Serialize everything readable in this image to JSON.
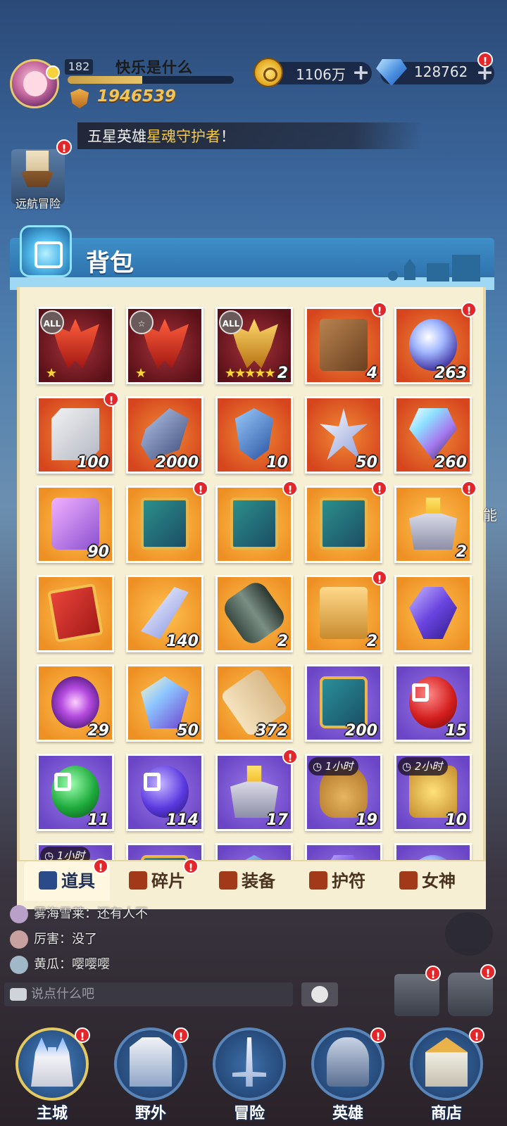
{
  "player": {
    "level": "182",
    "name": "快乐是什么",
    "power": "1946539",
    "exp_fraction": 0.45
  },
  "resources": {
    "gold": "1106万",
    "gems": "128762",
    "gem_badge": "!"
  },
  "announcement": {
    "prefix": "五星英雄",
    "highlight": "星魂守护者",
    "suffix": "！"
  },
  "voyage": {
    "label": "远航冒险",
    "badge": "!"
  },
  "bag": {
    "title": "背包"
  },
  "items": [
    {
      "art": "a-mask",
      "bg": "dark",
      "tag": "ALL",
      "count": "",
      "badge": false,
      "stars": "★"
    },
    {
      "art": "a-mask",
      "bg": "dark",
      "tag": "☆",
      "count": "",
      "badge": false,
      "stars": "★"
    },
    {
      "art": "a-mask gold",
      "bg": "dark",
      "tag": "ALL",
      "count": "2",
      "badge": false,
      "stars": "★★★★★"
    },
    {
      "art": "a-book",
      "bg": "red",
      "count": "4",
      "badge": true
    },
    {
      "art": "a-orb",
      "bg": "red",
      "count": "263",
      "badge": true
    },
    {
      "art": "a-cube",
      "bg": "red",
      "count": "100",
      "badge": true
    },
    {
      "art": "a-rock",
      "bg": "red",
      "count": "2000",
      "badge": false
    },
    {
      "art": "a-crystal",
      "bg": "red",
      "count": "10",
      "badge": false
    },
    {
      "art": "a-star",
      "bg": "red",
      "count": "50",
      "badge": false
    },
    {
      "art": "a-gem",
      "bg": "red",
      "count": "260",
      "badge": false
    },
    {
      "art": "a-puzzle",
      "bg": "orange",
      "count": "90",
      "badge": false
    },
    {
      "art": "a-card",
      "bg": "orange",
      "count": "",
      "badge": true
    },
    {
      "art": "a-card",
      "bg": "orange",
      "count": "",
      "badge": true
    },
    {
      "art": "a-card",
      "bg": "orange",
      "count": "",
      "badge": true
    },
    {
      "art": "a-altar",
      "bg": "orange",
      "count": "2",
      "badge": true
    },
    {
      "art": "a-redcard",
      "bg": "orange",
      "count": "",
      "badge": false
    },
    {
      "art": "a-shard",
      "bg": "orange",
      "count": "140",
      "badge": false
    },
    {
      "art": "a-tube",
      "bg": "orange",
      "count": "2",
      "badge": false
    },
    {
      "art": "a-chest",
      "bg": "orange",
      "count": "2",
      "badge": true
    },
    {
      "art": "a-bigem",
      "bg": "orange",
      "count": "",
      "badge": false
    },
    {
      "art": "a-swirl",
      "bg": "orange",
      "count": "29",
      "badge": false
    },
    {
      "art": "a-frame",
      "bg": "orange",
      "count": "50",
      "badge": false
    },
    {
      "art": "a-scroll",
      "bg": "orange",
      "count": "372",
      "badge": false
    },
    {
      "art": "a-shield",
      "bg": "purple",
      "count": "200",
      "badge": false
    },
    {
      "art": "a-ball-red",
      "bg": "purple",
      "count": "15",
      "badge": false
    },
    {
      "art": "a-ball-green",
      "bg": "purple",
      "count": "11",
      "badge": false
    },
    {
      "art": "a-ball-blue",
      "bg": "purple",
      "count": "114",
      "badge": false
    },
    {
      "art": "a-altar",
      "bg": "purple",
      "count": "17",
      "badge": true
    },
    {
      "art": "a-bag",
      "bg": "purple",
      "count": "19",
      "badge": false,
      "timer": "1小时"
    },
    {
      "art": "a-goldbag",
      "bg": "purple",
      "count": "10",
      "badge": false,
      "timer": "2小时"
    },
    {
      "art": "a-bag",
      "bg": "purple",
      "count": "",
      "badge": false,
      "timer": "1小时"
    },
    {
      "art": "a-shield",
      "bg": "purple",
      "count": "",
      "badge": false
    },
    {
      "art": "a-crystal",
      "bg": "purple",
      "count": "",
      "badge": false
    },
    {
      "art": "a-bigem",
      "bg": "purple",
      "count": "",
      "badge": false
    },
    {
      "art": "a-orb",
      "bg": "purple",
      "count": "",
      "badge": false
    }
  ],
  "tabs": [
    {
      "label": "道具",
      "badge": "!",
      "active": true,
      "icon_color": "#2a4a8a"
    },
    {
      "label": "碎片",
      "badge": "!",
      "active": false,
      "icon_color": "#a23a1a"
    },
    {
      "label": "装备",
      "badge": "",
      "active": false,
      "icon_color": "#a23a1a"
    },
    {
      "label": "护符",
      "badge": "",
      "active": false,
      "icon_color": "#a23a1a"
    },
    {
      "label": "女神",
      "badge": "",
      "active": false,
      "icon_color": "#a23a1a"
    }
  ],
  "chat": {
    "messages": [
      {
        "text": "雾海雪莱：还有人不"
      },
      {
        "text": "厉害：没了"
      },
      {
        "text": "黄瓜：嘤嘤嘤"
      }
    ],
    "placeholder": "说点什么吧"
  },
  "side": {
    "right_edge_text": "能"
  },
  "nav": [
    {
      "label": "主城",
      "badge": "!",
      "active": true,
      "art": "castle"
    },
    {
      "label": "野外",
      "badge": "!",
      "active": false,
      "art": "gate"
    },
    {
      "label": "冒险",
      "badge": "",
      "active": false,
      "art": "sword"
    },
    {
      "label": "英雄",
      "badge": "!",
      "active": false,
      "art": "helmet"
    },
    {
      "label": "商店",
      "badge": "!",
      "active": false,
      "art": "shop"
    }
  ],
  "colors": {
    "badge_red": "#e2262a",
    "panel_blue": "#2a6aa6",
    "panel_cream": "#f7efd3",
    "power_gold": "#f2c453"
  }
}
